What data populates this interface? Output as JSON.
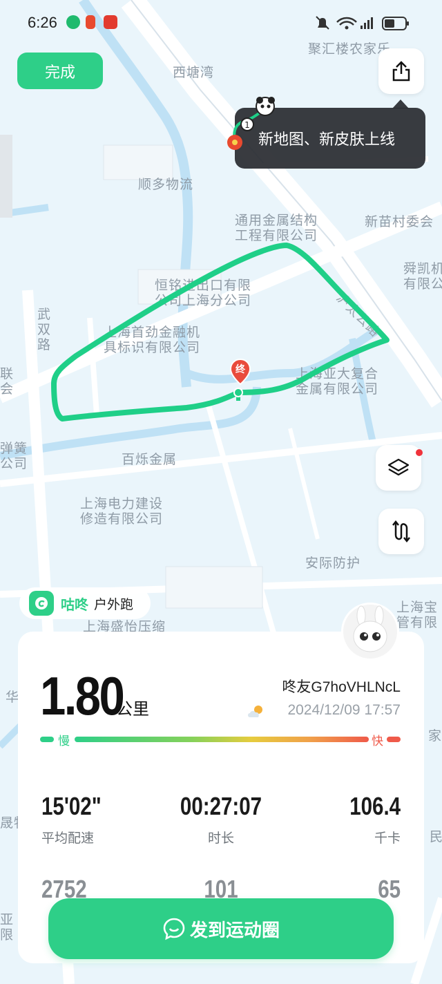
{
  "status_bar": {
    "time": "6:26"
  },
  "header": {
    "done_label": "完成"
  },
  "tooltip": {
    "text": "新地图、新皮肤上线"
  },
  "map": {
    "labels": [
      "聚汇楼农家乐",
      "西塘湾",
      "顺多物流",
      "通用金属结构\n工程有限公司",
      "新苗村委会",
      "舜凯机\n有限公",
      "恒铭进出口有限\n公司上海分公司",
      "沪太公路",
      "武\n双\n路",
      "上海首劲金融机\n具标识有限公司",
      "上海亚大复合\n金属有限公司",
      "联\n会",
      "弹簧\n公司",
      "百烁金属",
      "上海电力建设\n修造有限公司",
      "安际防护",
      "上海宝\n管有限",
      "上海盛怡压缩",
      "华",
      "家",
      "晟牧",
      "民",
      "亚\n限"
    ],
    "end_marker_label": "终"
  },
  "brand": {
    "name": "咕咚",
    "sport": "户外跑"
  },
  "run": {
    "distance": "1.80",
    "distance_unit": "公里",
    "user": "咚友G7hoVHLNcL",
    "datetime": "2024/12/09 17:57",
    "pace_slow_label": "慢",
    "pace_fast_label": "快",
    "stats": [
      {
        "value": "15'02\"",
        "label": "平均配速"
      },
      {
        "value": "00:27:07",
        "label": "时长"
      },
      {
        "value": "106.4",
        "label": "千卡"
      }
    ],
    "stats2": [
      {
        "value": "2752"
      },
      {
        "value": "101"
      },
      {
        "value": "65"
      }
    ]
  },
  "share": {
    "label": "发到运动圈"
  },
  "colors": {
    "accent": "#2ecf88",
    "route": "#1fcf88",
    "end_marker": "#e94b3c"
  },
  "icons": [
    "share-icon",
    "layers-icon",
    "route-toggle-icon",
    "chat-bubble-icon"
  ]
}
